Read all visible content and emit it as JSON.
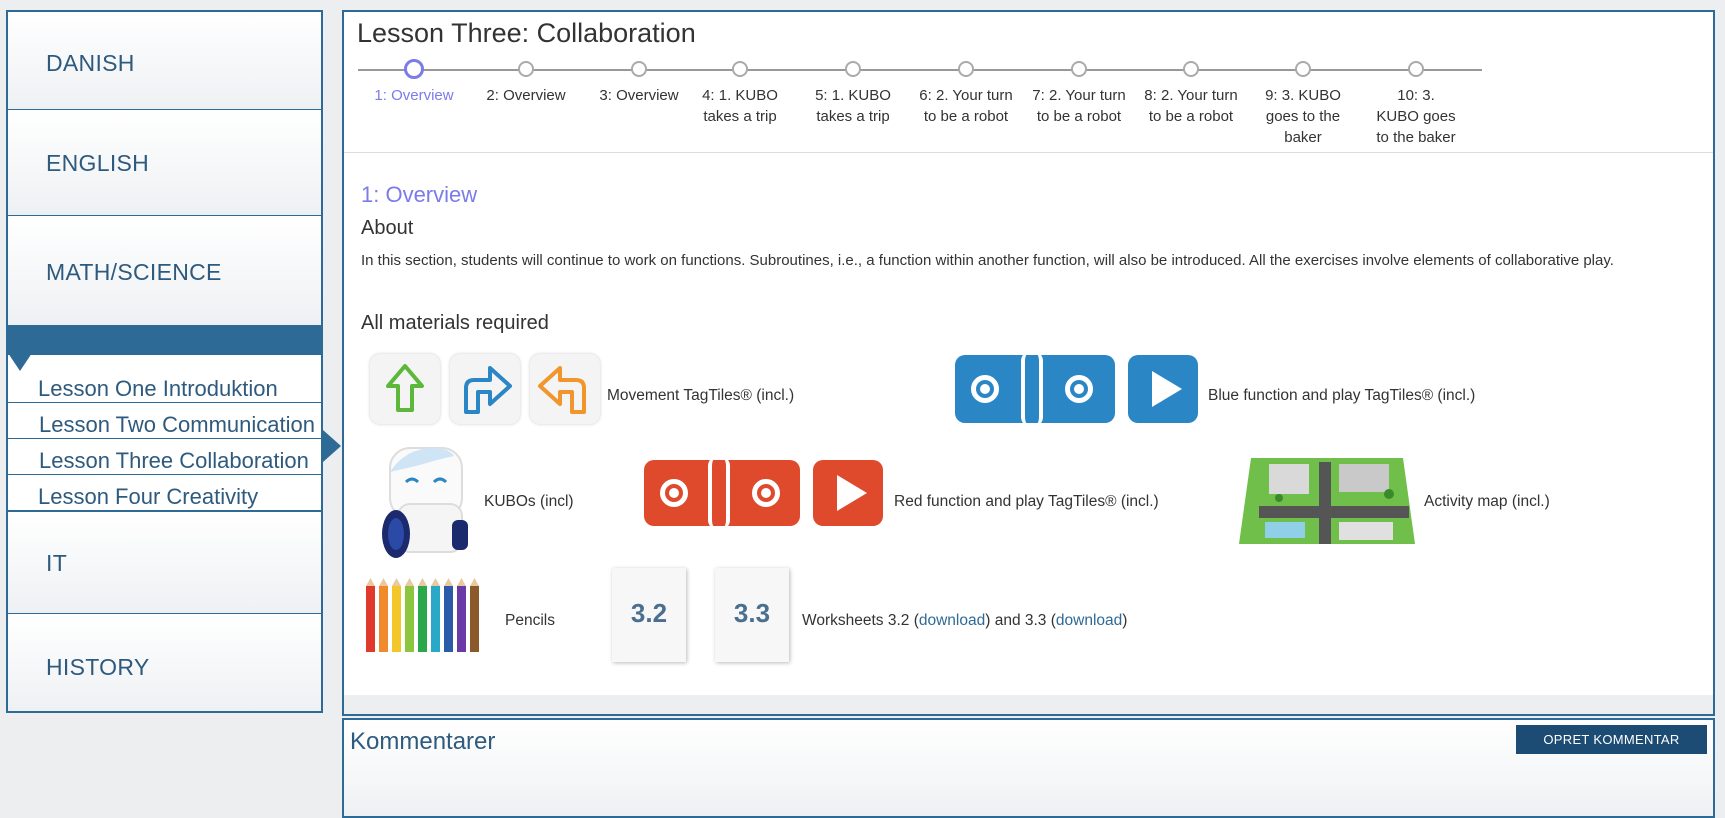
{
  "sidebar": {
    "items": [
      {
        "label": "DANISH"
      },
      {
        "label": "ENGLISH"
      },
      {
        "label": "MATH/SCIENCE"
      },
      {
        "label": "IT"
      },
      {
        "label": "HISTORY"
      }
    ],
    "lessons": [
      {
        "label": "Lesson One Introduktion"
      },
      {
        "label": "Lesson Two Communication"
      },
      {
        "label": "Lesson Three Collaboration"
      },
      {
        "label": "Lesson Four Creativity"
      }
    ]
  },
  "main": {
    "title": "Lesson Three: Collaboration",
    "steps": [
      "1: Overview",
      "2: Overview",
      "3: Overview",
      "4: 1. KUBO takes a trip",
      "5: 1. KUBO takes a trip",
      "6: 2. Your turn to be a robot",
      "7: 2. Your turn to be a robot",
      "8: 2. Your turn to be a robot",
      "9: 3. KUBO goes to the baker",
      "10: 3. KUBO goes to the baker"
    ],
    "section_title": "1: Overview",
    "about_heading": "About",
    "about_text": "In this section, students will continue to work on functions. Subroutines, i.e., a function within another function, will also be introduced. All the exercises involve elements of collaborative play.",
    "materials_heading": "All materials required",
    "materials": {
      "movement": "Movement TagTiles® (incl.)",
      "blue": "Blue function and play TagTiles® (incl.)",
      "kubos": "KUBOs  (incl)",
      "red": "Red function and play TagTiles® (incl.)",
      "map": "Activity map (incl.)",
      "pencils": "Pencils",
      "worksheets_prefix": "Worksheets 3.2 (",
      "download1": "download",
      "worksheets_mid": ") and 3.3 (",
      "download2": "download",
      "worksheets_suffix": ")",
      "ws1": "3.2",
      "ws2": "3.3"
    }
  },
  "comments": {
    "title": "Kommentarer",
    "button": "OPRET KOMMENTAR"
  },
  "colors": {
    "brand": "#2e6a96",
    "active_step": "#7b7bea",
    "tile_blue": "#2b86c5",
    "tile_red": "#e04a2c"
  }
}
